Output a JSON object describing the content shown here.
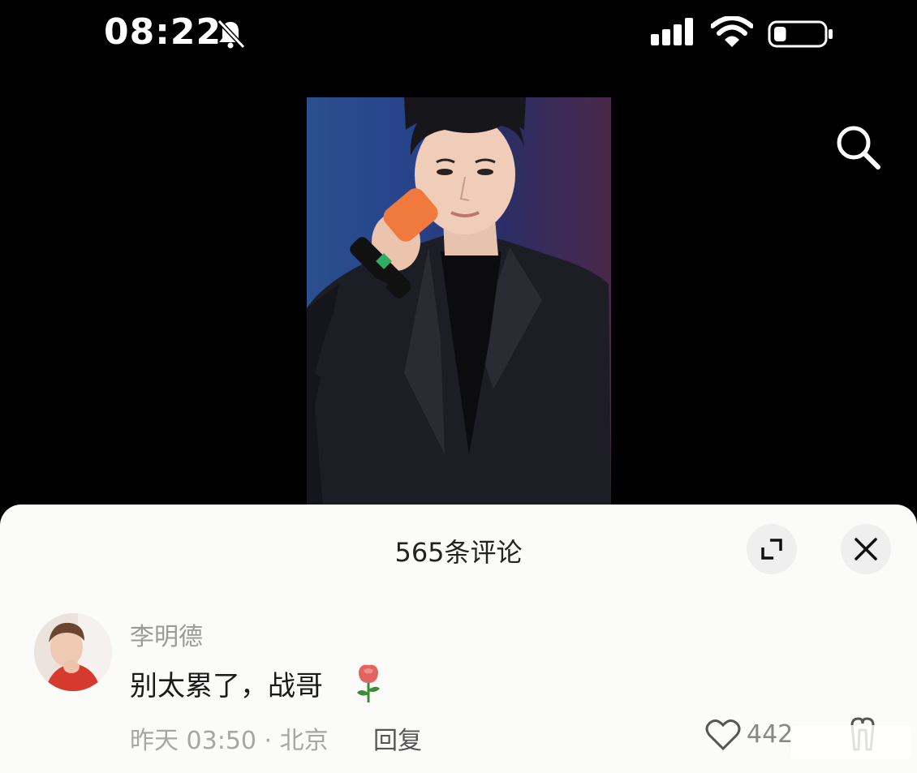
{
  "status_bar": {
    "time": "08:22",
    "icons": [
      "bell-muted-icon",
      "signal-icon",
      "wifi-icon",
      "battery-icon"
    ],
    "battery_level": 0.25
  },
  "video": {
    "search_icon": "search-icon"
  },
  "comments": {
    "title": "565条评论",
    "expand_icon": "expand-icon",
    "close_icon": "close-icon",
    "items": [
      {
        "username": "李明德",
        "text": "别太累了，战哥",
        "emoji": "rose-icon",
        "time_location": "昨天 03:50 · 北京",
        "reply_label": "回复",
        "like_count": "442"
      }
    ]
  },
  "colors": {
    "sheet_background": "#fbfbfa",
    "text_primary": "#1a1a1a",
    "text_secondary": "#9a9a9a"
  }
}
